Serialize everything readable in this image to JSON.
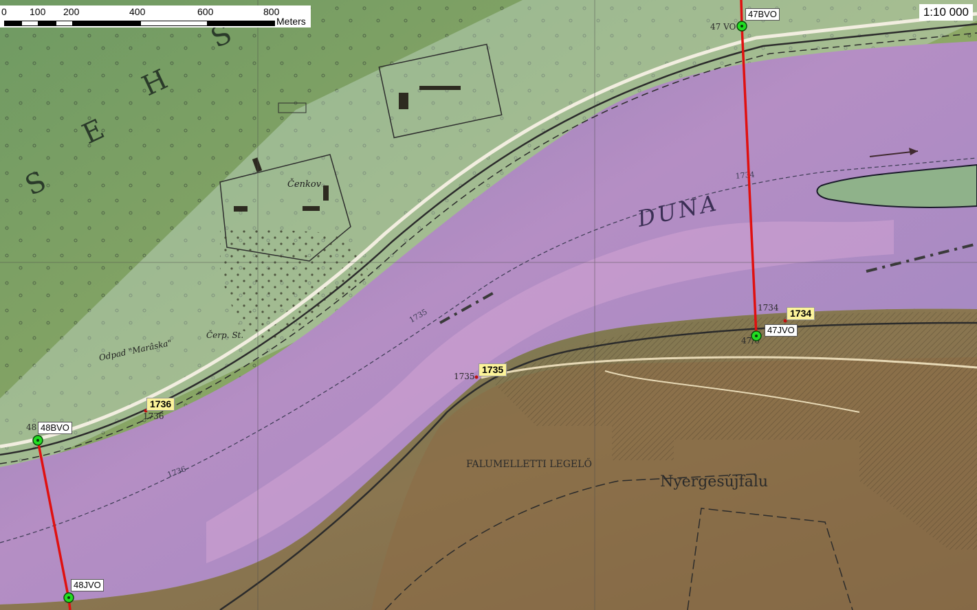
{
  "map": {
    "scale_ratio": "1:10 000",
    "scalebar": {
      "ticks": [
        "0",
        "100",
        "200",
        "400",
        "600",
        "800"
      ],
      "unit": "Meters"
    },
    "river_name": "DUNA",
    "place_labels": {
      "village": "Nyergesújfalu",
      "settlement_north": "Čenkov",
      "pasture": "FALUMELLETTI LEGELŐ",
      "odpad": "Odpad \"Marâska\"",
      "cerp": "Čerp. St.",
      "estate_letters": [
        "S",
        "E",
        "H",
        "S"
      ]
    },
    "profile_points": [
      {
        "id": "47BVO"
      },
      {
        "id": "47JVO"
      },
      {
        "id": "48BVO"
      },
      {
        "id": "48JVO"
      }
    ],
    "river_km_labels": [
      "1734",
      "1735",
      "1736"
    ],
    "base_map_km_labels": [
      "1734",
      "1734",
      "1735",
      "1735",
      "1736",
      "1736",
      "47 VO",
      "47/0",
      "48"
    ],
    "colors": {
      "profile_line": "#e01010",
      "point_marker": "#22dd22",
      "km_label_bg": "#fcf39a"
    }
  }
}
